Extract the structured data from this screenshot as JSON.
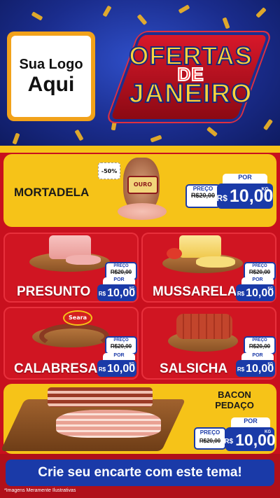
{
  "header": {
    "logo_line1": "Sua Logo",
    "logo_line2": "Aqui",
    "title_line1": "OFERTAS",
    "title_line2": "DE",
    "title_line3": "JANEIRO"
  },
  "products": [
    {
      "name": "MORTADELA",
      "discount": "-50%",
      "preco_label": "PREÇO",
      "old_price": "R$20,00",
      "por_label": "POR",
      "currency": "R$",
      "price": "10,00",
      "unit": "KG",
      "brand": "OURO"
    },
    {
      "name": "PRESUNTO",
      "preco_label": "PREÇO",
      "old_price": "R$20,00",
      "por_label": "POR",
      "currency": "R$",
      "price": "10,00",
      "unit": "KG"
    },
    {
      "name": "MUSSARELA",
      "preco_label": "PREÇO",
      "old_price": "R$20,00",
      "por_label": "POR",
      "currency": "R$",
      "price": "10,00",
      "unit": "KG"
    },
    {
      "name": "CALABRESA",
      "preco_label": "PREÇO",
      "old_price": "R$20,00",
      "por_label": "POR",
      "currency": "R$",
      "price": "10,00",
      "unit": "KG",
      "brand": "Seara"
    },
    {
      "name": "SALSICHA",
      "preco_label": "PREÇO",
      "old_price": "R$20,00",
      "por_label": "POR",
      "currency": "R$",
      "price": "10,00",
      "unit": "KG"
    },
    {
      "name_line1": "BACON",
      "name_line2": "PEDAÇO",
      "preco_label": "PREÇO",
      "old_price": "R$20,00",
      "por_label": "POR",
      "currency": "R$",
      "price": "10,00",
      "unit": "KG"
    }
  ],
  "footer": {
    "cta": "Crie seu encarte com este tema!",
    "disclaimer": "*Imagens Meramente Ilustrativas"
  },
  "colors": {
    "red": "#d01522",
    "yellow": "#f6c318",
    "blue": "#1a3aa8",
    "navy": "#1a2c8c"
  }
}
